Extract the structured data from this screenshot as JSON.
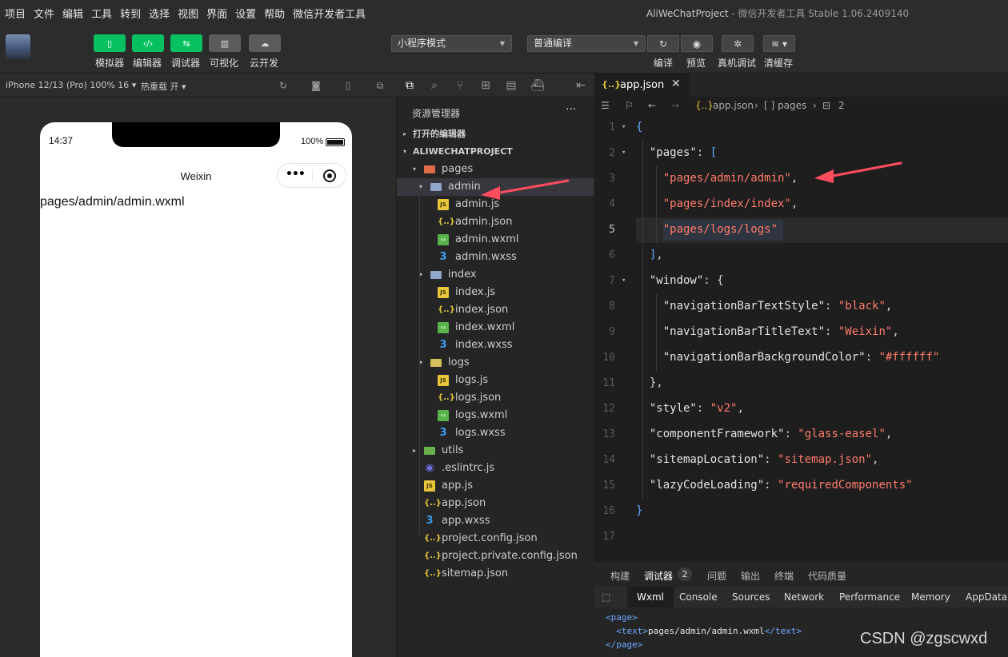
{
  "menubar": {
    "items": [
      "项目",
      "文件",
      "编辑",
      "工具",
      "转到",
      "选择",
      "视图",
      "界面",
      "设置",
      "帮助",
      "微信开发者工具"
    ],
    "project_name": "AliWeChatProject",
    "app_title": " - 微信开发者工具 Stable 1.06.2409140"
  },
  "toolbar": {
    "left_buttons": [
      {
        "label": "模拟器",
        "icon": "phone-icon"
      },
      {
        "label": "编辑器",
        "icon": "code-icon"
      },
      {
        "label": "调试器",
        "icon": "debug-icon"
      },
      {
        "label": "可视化",
        "icon": "layout-icon"
      },
      {
        "label": "云开发",
        "icon": "cloud-icon"
      }
    ],
    "mode_select": "小程序模式",
    "compile_select": "普通编译",
    "right_buttons": [
      {
        "label": "编译",
        "icon": "refresh-icon"
      },
      {
        "label": "预览",
        "icon": "eye-icon"
      },
      {
        "label": "真机调试",
        "icon": "bug-icon"
      },
      {
        "label": "清缓存",
        "icon": "layers-icon"
      }
    ]
  },
  "simulator": {
    "device": "iPhone 12/13 (Pro) 100% 16 ▾",
    "hot_reload": "热重载 开 ▾",
    "status_time": "14:37",
    "battery": "100%",
    "nav_title": "Weixin",
    "page_text": "pages/admin/admin.wxml"
  },
  "explorer": {
    "title": "资源管理器",
    "more": "···",
    "open_editors": "打开的编辑器",
    "project": "ALIWECHATPROJECT",
    "tree": [
      {
        "label": "pages",
        "type": "folder-open",
        "depth": 1,
        "twisty": "▾"
      },
      {
        "label": "admin",
        "type": "folder",
        "depth": 2,
        "twisty": "▾"
      },
      {
        "label": "admin.js",
        "type": "js",
        "depth": 3
      },
      {
        "label": "admin.json",
        "type": "json",
        "depth": 3
      },
      {
        "label": "admin.wxml",
        "type": "wxml",
        "depth": 3
      },
      {
        "label": "admin.wxss",
        "type": "wxss",
        "depth": 3
      },
      {
        "label": "index",
        "type": "folder",
        "depth": 2,
        "twisty": "▾"
      },
      {
        "label": "index.js",
        "type": "js",
        "depth": 3
      },
      {
        "label": "index.json",
        "type": "json",
        "depth": 3
      },
      {
        "label": "index.wxml",
        "type": "wxml",
        "depth": 3
      },
      {
        "label": "index.wxss",
        "type": "wxss",
        "depth": 3
      },
      {
        "label": "logs",
        "type": "folder-logs",
        "depth": 2,
        "twisty": "▾"
      },
      {
        "label": "logs.js",
        "type": "js",
        "depth": 3
      },
      {
        "label": "logs.json",
        "type": "json",
        "depth": 3
      },
      {
        "label": "logs.wxml",
        "type": "wxml",
        "depth": 3
      },
      {
        "label": "logs.wxss",
        "type": "wxss",
        "depth": 3
      },
      {
        "label": "utils",
        "type": "folder-utils",
        "depth": 1,
        "twisty": "▸"
      },
      {
        "label": ".eslintrc.js",
        "type": "eslint",
        "depth": 1
      },
      {
        "label": "app.js",
        "type": "js",
        "depth": 1
      },
      {
        "label": "app.json",
        "type": "json",
        "depth": 1
      },
      {
        "label": "app.wxss",
        "type": "wxss",
        "depth": 1
      },
      {
        "label": "project.config.json",
        "type": "json",
        "depth": 1
      },
      {
        "label": "project.private.config.json",
        "type": "json",
        "depth": 1
      },
      {
        "label": "sitemap.json",
        "type": "json",
        "depth": 1
      }
    ]
  },
  "editor": {
    "tab": "app.json",
    "breadcrumb": [
      "app.json",
      "[ ] pages",
      "2"
    ],
    "lines": [
      [
        {
          "t": "{",
          "c": "br"
        }
      ],
      [
        {
          "t": "  \"pages\"",
          "c": "k"
        },
        {
          "t": ": ",
          "c": "p"
        },
        {
          "t": "[",
          "c": "br"
        }
      ],
      [
        {
          "t": "    \"pages/admin/admin\"",
          "c": "s"
        },
        {
          "t": ",",
          "c": "p"
        }
      ],
      [
        {
          "t": "    \"pages/index/index\"",
          "c": "s"
        },
        {
          "t": ",",
          "c": "p"
        }
      ],
      [
        {
          "t": "    \"pages/logs/logs\"",
          "c": "s"
        }
      ],
      [
        {
          "t": "  ]",
          "c": "br"
        },
        {
          "t": ",",
          "c": "p"
        }
      ],
      [
        {
          "t": "  \"window\"",
          "c": "k"
        },
        {
          "t": ": {",
          "c": "p"
        }
      ],
      [
        {
          "t": "    \"navigationBarTextStyle\"",
          "c": "k"
        },
        {
          "t": ": ",
          "c": "p"
        },
        {
          "t": "\"black\"",
          "c": "s"
        },
        {
          "t": ",",
          "c": "p"
        }
      ],
      [
        {
          "t": "    \"navigationBarTitleText\"",
          "c": "k"
        },
        {
          "t": ": ",
          "c": "p"
        },
        {
          "t": "\"Weixin\"",
          "c": "s"
        },
        {
          "t": ",",
          "c": "p"
        }
      ],
      [
        {
          "t": "    \"navigationBarBackgroundColor\"",
          "c": "k"
        },
        {
          "t": ": ",
          "c": "p"
        },
        {
          "t": "\"#ffffff\"",
          "c": "s"
        }
      ],
      [
        {
          "t": "  },",
          "c": "p"
        }
      ],
      [
        {
          "t": "  \"style\"",
          "c": "k"
        },
        {
          "t": ": ",
          "c": "p"
        },
        {
          "t": "\"v2\"",
          "c": "s"
        },
        {
          "t": ",",
          "c": "p"
        }
      ],
      [
        {
          "t": "  \"componentFramework\"",
          "c": "k"
        },
        {
          "t": ": ",
          "c": "p"
        },
        {
          "t": "\"glass-easel\"",
          "c": "s"
        },
        {
          "t": ",",
          "c": "p"
        }
      ],
      [
        {
          "t": "  \"sitemapLocation\"",
          "c": "k"
        },
        {
          "t": ": ",
          "c": "p"
        },
        {
          "t": "\"sitemap.json\"",
          "c": "s"
        },
        {
          "t": ",",
          "c": "p"
        }
      ],
      [
        {
          "t": "  \"lazyCodeLoading\"",
          "c": "k"
        },
        {
          "t": ": ",
          "c": "p"
        },
        {
          "t": "\"requiredComponents\"",
          "c": "s"
        }
      ],
      [
        {
          "t": "}",
          "c": "br"
        }
      ],
      []
    ],
    "current_line": 5
  },
  "panel": {
    "tabs": [
      "构建",
      "调试器",
      "问题",
      "输出",
      "终端",
      "代码质量"
    ],
    "badge": "2",
    "devtools_tabs": [
      "Wxml",
      "Console",
      "Sources",
      "Network",
      "Performance",
      "Memory",
      "AppData"
    ],
    "wxml_lines": [
      [
        {
          "t": "<page>",
          "c": "tag"
        }
      ],
      [
        {
          "t": "  <text>",
          "c": "tag"
        },
        {
          "t": "pages/admin/admin.wxml",
          "c": "txt"
        },
        {
          "t": "</text>",
          "c": "tag"
        }
      ],
      [
        {
          "t": "</page>",
          "c": "tag"
        }
      ]
    ]
  },
  "watermark": "CSDN @zgscwxd",
  "colors": {
    "accent_green": "#07c160",
    "annotation_arrow": "#ff4d5e",
    "string": "#ff7b6a",
    "bracket": "#5fa8ff"
  }
}
